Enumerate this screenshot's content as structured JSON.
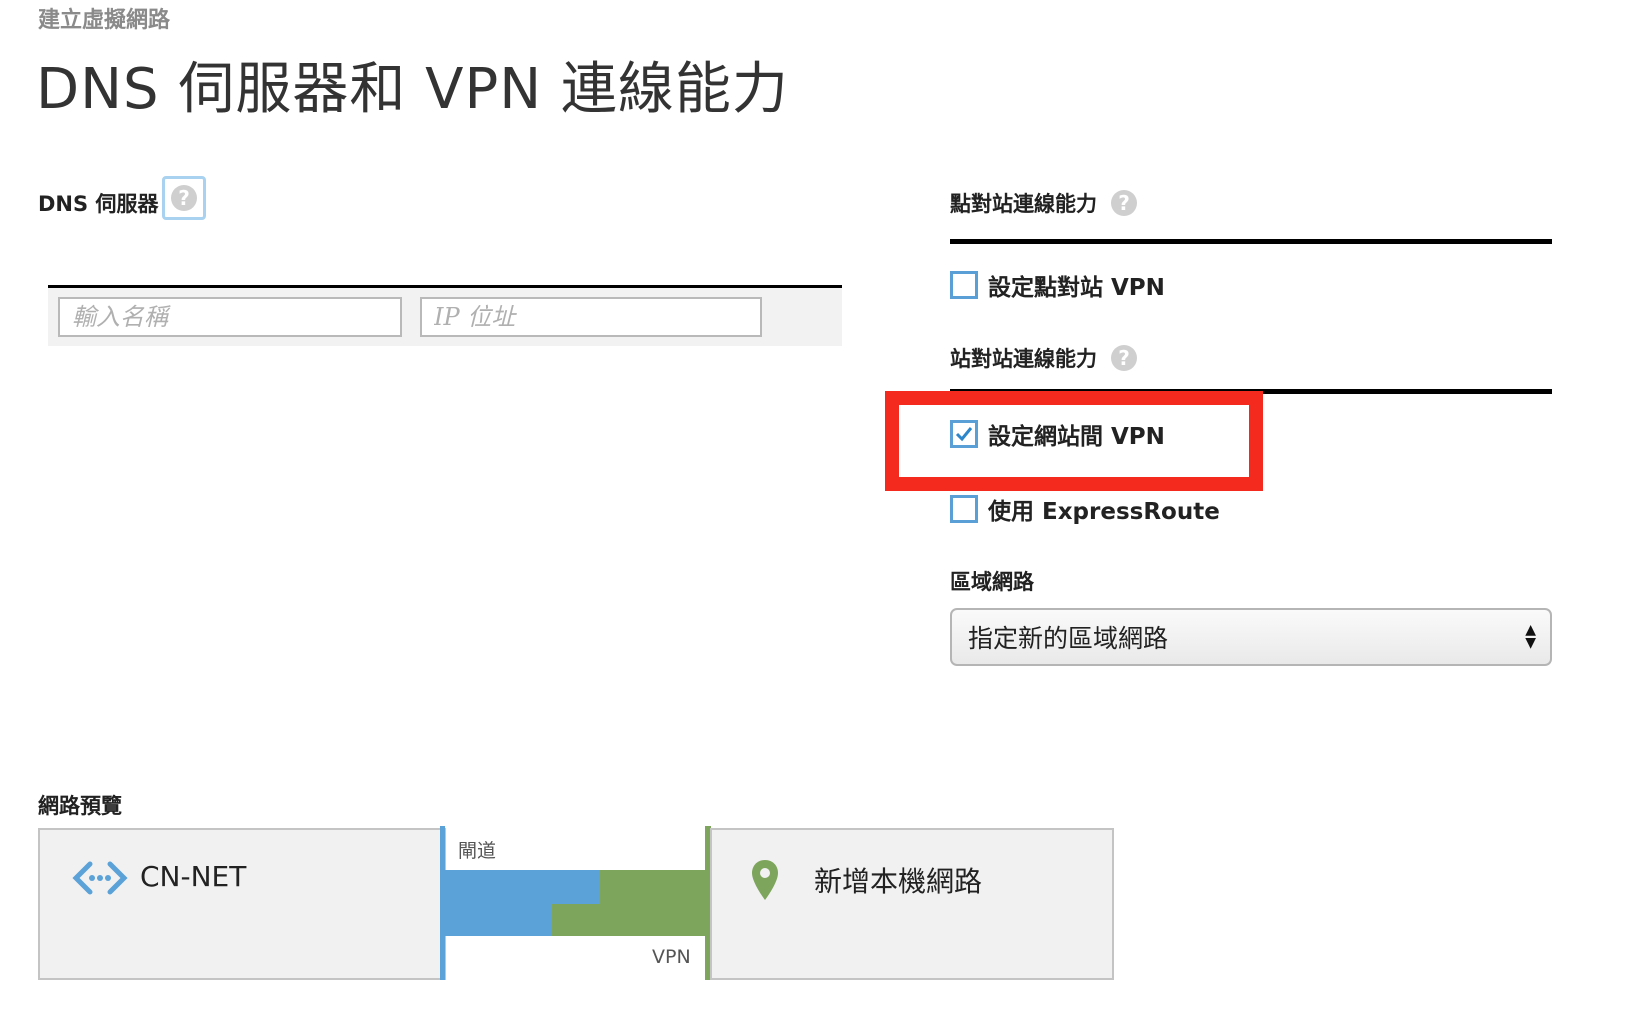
{
  "breadcrumb": "建立虛擬網路",
  "title": "DNS 伺服器和 VPN 連線能力",
  "dns": {
    "label": "DNS 伺服器",
    "help": "?",
    "name_placeholder": "輸入名稱",
    "ip_placeholder": "IP 位址"
  },
  "p2s": {
    "label": "點對站連線能力",
    "help": "?",
    "checkbox_label": "設定點對站 VPN",
    "checked": false
  },
  "s2s": {
    "label": "站對站連線能力",
    "help": "?",
    "vpn_label": "設定網站間 VPN",
    "vpn_checked": true,
    "expressroute_label": "使用 ExpressRoute",
    "expressroute_checked": false
  },
  "local_network": {
    "label": "區域網路",
    "selected": "指定新的區域網路"
  },
  "preview": {
    "label": "網路預覽",
    "vnet_name": "CN-NET",
    "gateway_label": "閘道",
    "vpn_label": "VPN",
    "local_name": "新增本機網路"
  },
  "colors": {
    "highlight": "#f52a1f",
    "vnet_blue": "#5ba2d8",
    "local_green": "#7da55b",
    "checkbox_border": "#5aa0d6"
  },
  "icons": {
    "help": "question-circle-icon",
    "vnet": "virtual-network-icon",
    "local": "location-pin-icon",
    "check": "checkmark-icon",
    "select": "up-down-arrows-icon"
  }
}
